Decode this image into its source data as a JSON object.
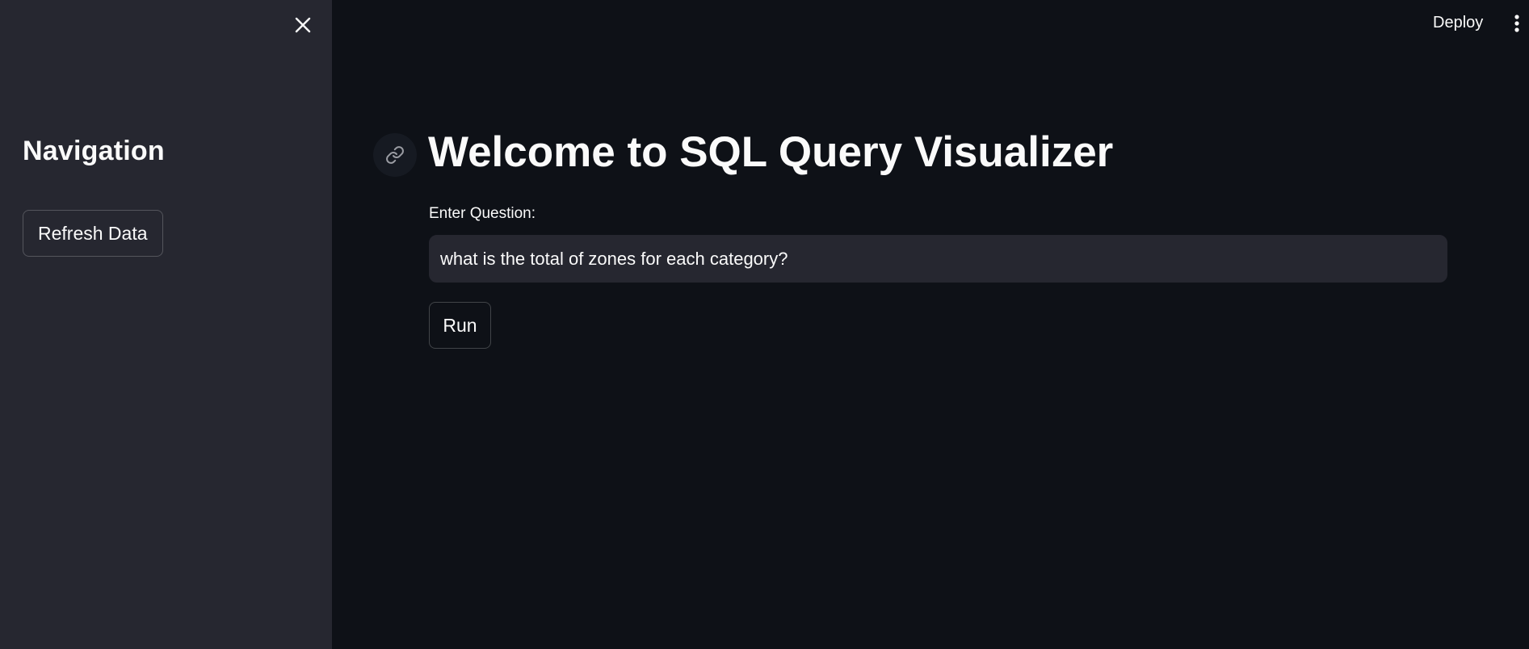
{
  "sidebar": {
    "title": "Navigation",
    "refresh_label": "Refresh Data",
    "close_icon": "close-icon"
  },
  "header": {
    "deploy_label": "Deploy",
    "menu_icon": "vertical-ellipsis-icon"
  },
  "main": {
    "title": "Welcome to SQL Query Visualizer",
    "anchor_icon": "link-icon",
    "question_label": "Enter Question:",
    "question_value": "what is the total of zones for each category?",
    "run_label": "Run"
  },
  "colors": {
    "app_background": "#0e1117",
    "sidebar_background": "#262730",
    "input_background": "#262730",
    "text": "#fafafa"
  }
}
